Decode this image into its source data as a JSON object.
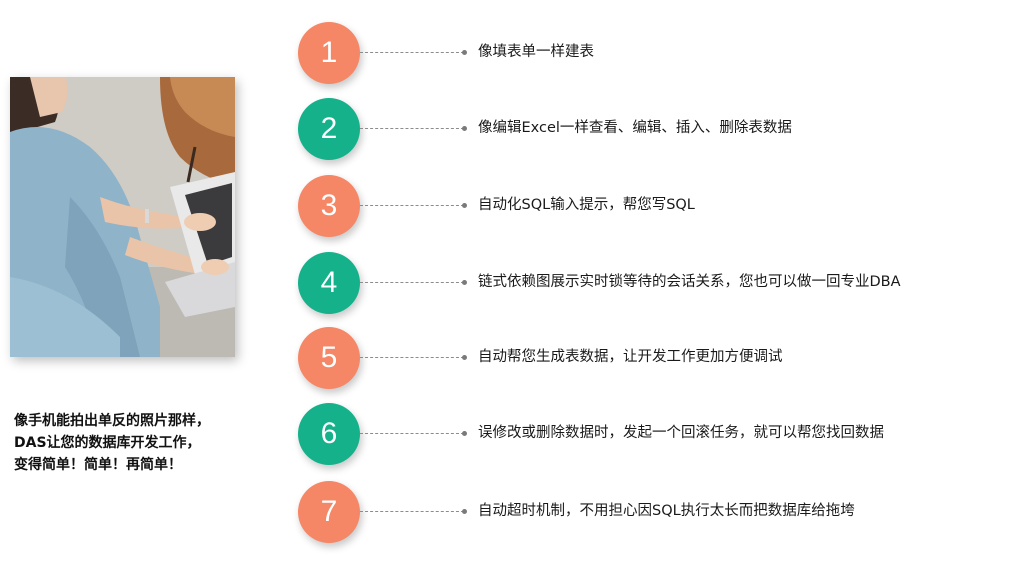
{
  "caption": {
    "line1": "像手机能拍出单反的照片那样，",
    "line2": "DAS让您的数据库开发工作，",
    "line3": "变得简单！简单！再简单！"
  },
  "steps": [
    {
      "number": "1",
      "color": "orange",
      "text": "像填表单一样建表"
    },
    {
      "number": "2",
      "color": "green",
      "text": "像编辑Excel一样查看、编辑、插入、删除表数据"
    },
    {
      "number": "3",
      "color": "orange",
      "text": "自动化SQL输入提示，帮您写SQL"
    },
    {
      "number": "4",
      "color": "green",
      "text": "链式依赖图展示实时锁等待的会话关系，您也可以做一回专业DBA"
    },
    {
      "number": "5",
      "color": "orange",
      "text": "自动帮您生成表数据，让开发工作更加方便调试"
    },
    {
      "number": "6",
      "color": "green",
      "text": "误修改或删除数据时，发起一个回滚任务，就可以帮您找回数据"
    },
    {
      "number": "7",
      "color": "orange",
      "text": "自动超时机制，不用担心因SQL执行太长而把数据库给拖垮"
    }
  ],
  "colors": {
    "orange": "#f58766",
    "green": "#15b18b"
  }
}
